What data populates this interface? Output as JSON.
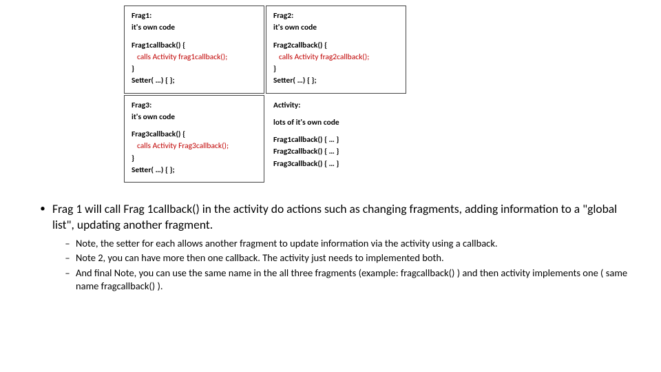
{
  "frag1": {
    "title": "Frag1:",
    "own": "it's own code",
    "cbhead": "Frag1callback() {",
    "call": "calls Activity frag1callback();",
    "close": "}",
    "setter": "Setter( …) { };"
  },
  "frag2": {
    "title": "Frag2:",
    "own": "it's own code",
    "cbhead": "Frag2callback() {",
    "call": "calls Activity frag2callback();",
    "close": "}",
    "setter": "Setter( …) { };"
  },
  "frag3": {
    "title": "Frag3:",
    "own": "it's own code",
    "cbhead": "Frag3callback() {",
    "call": "calls Activity Frag3callback();",
    "close": "}",
    "setter": "Setter( …) { };"
  },
  "activity": {
    "title": "Activity:",
    "own": "lots of it's own code",
    "cb1": "Frag1callback() { … }",
    "cb2": "Frag2callback() { … }",
    "cb3": "Frag3callback() { … }"
  },
  "bullets": {
    "main": "Frag 1 will call Frag 1callback() in the activity do actions such as changing fragments, adding information to a \"global list\", updating another fragment.",
    "sub1": "Note, the setter for each allows another fragment to update information via the activity using a callback.",
    "sub2": "Note 2, you can have more then one callback.  The activity just needs to implemented both.",
    "sub3": "And final Note, you can use the same name in the all three fragments (example: fragcallback() ) and then activity implements one  ( same name fragcallback() )."
  }
}
